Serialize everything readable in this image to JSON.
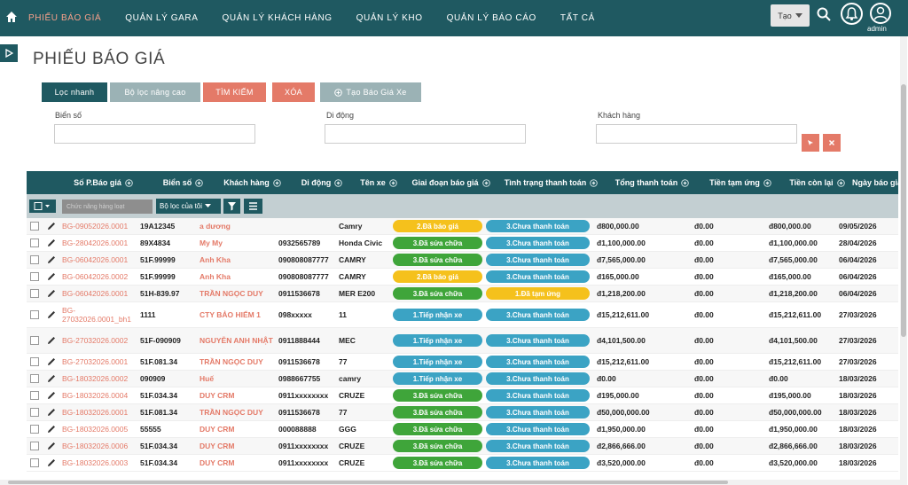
{
  "nav": {
    "items": [
      {
        "label": "PHIẾU BÁO GIÁ",
        "active": true
      },
      {
        "label": "QUẢN LÝ GARA",
        "active": false
      },
      {
        "label": "QUẢN LÝ KHÁCH HÀNG",
        "active": false
      },
      {
        "label": "QUẢN LÝ KHO",
        "active": false
      },
      {
        "label": "QUẢN LÝ BÁO CÁO",
        "active": false
      },
      {
        "label": "TẤT CẢ",
        "active": false
      }
    ],
    "create_label": "Tạo",
    "user_label": "admin"
  },
  "page": {
    "title": "PHIẾU BÁO GIÁ"
  },
  "tabs": {
    "quick": "Lọc nhanh",
    "advanced": "Bộ lọc nâng cao",
    "search": "TÌM KIẾM",
    "clear": "XÓA",
    "create": "Tạo Báo Giá Xe"
  },
  "filters": {
    "plate_label": "Biển số",
    "phone_label": "Di động",
    "customer_label": "Khách hàng",
    "plate_value": "",
    "phone_value": "",
    "customer_value": ""
  },
  "grid": {
    "headers": [
      "Số P.Báo giá",
      "Biển số",
      "Khách hàng",
      "Di động",
      "Tên xe",
      "Giai đoạn báo giá",
      "Tình trạng thanh toán",
      "Tổng thanh toán",
      "Tiền tạm ứng",
      "Tiền còn lại",
      "Ngày báo giá"
    ],
    "bulk_action": "Chức năng hàng loạt",
    "my_filter": "Bộ lọc của tôi",
    "rows": [
      {
        "code": "BG-09052026.0001",
        "plate": "19A12345",
        "customer": "a dương",
        "phone": "",
        "car": "Camry",
        "stage": "2.Đã báo giá",
        "stage_color": "#f5c11c",
        "pay": "3.Chưa thanh toán",
        "pay_color": "#3ba3c4",
        "total": "đ800,000.00",
        "advance": "đ0.00",
        "remain": "đ800,000.00",
        "date": "09/05/2026"
      },
      {
        "code": "BG-28042026.0001",
        "plate": "89X4834",
        "customer": "My My",
        "phone": "0932565789",
        "car": "Honda Civic",
        "stage": "3.Đã sửa chữa",
        "stage_color": "#3fa53a",
        "pay": "3.Chưa thanh toán",
        "pay_color": "#3ba3c4",
        "total": "đ1,100,000.00",
        "advance": "đ0.00",
        "remain": "đ1,100,000.00",
        "date": "28/04/2026"
      },
      {
        "code": "BG-06042026.0001",
        "plate": "51F.99999",
        "customer": "Anh Kha",
        "phone": "090808087777",
        "car": "CAMRY",
        "stage": "3.Đã sửa chữa",
        "stage_color": "#3fa53a",
        "pay": "3.Chưa thanh toán",
        "pay_color": "#3ba3c4",
        "total": "đ7,565,000.00",
        "advance": "đ0.00",
        "remain": "đ7,565,000.00",
        "date": "06/04/2026"
      },
      {
        "code": "BG-06042026.0002",
        "plate": "51F.99999",
        "customer": "Anh Kha",
        "phone": "090808087777",
        "car": "CAMRY",
        "stage": "2.Đã báo giá",
        "stage_color": "#f5c11c",
        "pay": "3.Chưa thanh toán",
        "pay_color": "#3ba3c4",
        "total": "đ165,000.00",
        "advance": "đ0.00",
        "remain": "đ165,000.00",
        "date": "06/04/2026"
      },
      {
        "code": "BG-06042026.0001",
        "plate": "51H-839.97",
        "customer": "TRẦN NGỌC DUY",
        "phone": "0911536678",
        "car": "MER E200",
        "stage": "3.Đã sửa chữa",
        "stage_color": "#3fa53a",
        "pay": "1.Đã tạm ứng",
        "pay_color": "#f5c11c",
        "total": "đ1,218,200.00",
        "advance": "đ0.00",
        "remain": "đ1,218,200.00",
        "date": "06/04/2026"
      },
      {
        "code": "BG-27032026.0001_bh1",
        "plate": "1111",
        "customer": "CTY BẢO HIỂM 1",
        "phone": "098xxxxx",
        "car": "11",
        "stage": "1.Tiếp nhận xe",
        "stage_color": "#3ba3c4",
        "pay": "3.Chưa thanh toán",
        "pay_color": "#3ba3c4",
        "total": "đ15,212,611.00",
        "advance": "đ0.00",
        "remain": "đ15,212,611.00",
        "date": "27/03/2026"
      },
      {
        "code": "BG-27032026.0002",
        "plate": "51F-090909",
        "customer": "NGUYỄN ANH NHẬT",
        "phone": "0911888444",
        "car": "MEC",
        "stage": "1.Tiếp nhận xe",
        "stage_color": "#3ba3c4",
        "pay": "3.Chưa thanh toán",
        "pay_color": "#3ba3c4",
        "total": "đ4,101,500.00",
        "advance": "đ0.00",
        "remain": "đ4,101,500.00",
        "date": "27/03/2026"
      },
      {
        "code": "BG-27032026.0001",
        "plate": "51F.081.34",
        "customer": "TRẦN NGỌC DUY",
        "phone": "0911536678",
        "car": "77",
        "stage": "1.Tiếp nhận xe",
        "stage_color": "#3ba3c4",
        "pay": "3.Chưa thanh toán",
        "pay_color": "#3ba3c4",
        "total": "đ15,212,611.00",
        "advance": "đ0.00",
        "remain": "đ15,212,611.00",
        "date": "27/03/2026"
      },
      {
        "code": "BG-18032026.0002",
        "plate": "090909",
        "customer": "Huế",
        "phone": "0988667755",
        "car": "camry",
        "stage": "1.Tiếp nhận xe",
        "stage_color": "#3ba3c4",
        "pay": "3.Chưa thanh toán",
        "pay_color": "#3ba3c4",
        "total": "đ0.00",
        "advance": "đ0.00",
        "remain": "đ0.00",
        "date": "18/03/2026"
      },
      {
        "code": "BG-18032026.0004",
        "plate": "51F.034.34",
        "customer": "DUY CRM",
        "phone": "0911xxxxxxxx",
        "car": "CRUZE",
        "stage": "3.Đã sửa chữa",
        "stage_color": "#3fa53a",
        "pay": "3.Chưa thanh toán",
        "pay_color": "#3ba3c4",
        "total": "đ195,000.00",
        "advance": "đ0.00",
        "remain": "đ195,000.00",
        "date": "18/03/2026"
      },
      {
        "code": "BG-18032026.0001",
        "plate": "51F.081.34",
        "customer": "TRẦN NGỌC DUY",
        "phone": "0911536678",
        "car": "77",
        "stage": "3.Đã sửa chữa",
        "stage_color": "#3fa53a",
        "pay": "3.Chưa thanh toán",
        "pay_color": "#3ba3c4",
        "total": "đ50,000,000.00",
        "advance": "đ0.00",
        "remain": "đ50,000,000.00",
        "date": "18/03/2026"
      },
      {
        "code": "BG-18032026.0005",
        "plate": "55555",
        "customer": "DUY CRM",
        "phone": "000088888",
        "car": "GGG",
        "stage": "3.Đã sửa chữa",
        "stage_color": "#3fa53a",
        "pay": "3.Chưa thanh toán",
        "pay_color": "#3ba3c4",
        "total": "đ1,950,000.00",
        "advance": "đ0.00",
        "remain": "đ1,950,000.00",
        "date": "18/03/2026"
      },
      {
        "code": "BG-18032026.0006",
        "plate": "51F.034.34",
        "customer": "DUY CRM",
        "phone": "0911xxxxxxxx",
        "car": "CRUZE",
        "stage": "3.Đã sửa chữa",
        "stage_color": "#3fa53a",
        "pay": "3.Chưa thanh toán",
        "pay_color": "#3ba3c4",
        "total": "đ2,866,666.00",
        "advance": "đ0.00",
        "remain": "đ2,866,666.00",
        "date": "18/03/2026"
      },
      {
        "code": "BG-18032026.0003",
        "plate": "51F.034.34",
        "customer": "DUY CRM",
        "phone": "0911xxxxxxxx",
        "car": "CRUZE",
        "stage": "3.Đã sửa chữa",
        "stage_color": "#3fa53a",
        "pay": "3.Chưa thanh toán",
        "pay_color": "#3ba3c4",
        "total": "đ3,520,000.00",
        "advance": "đ0.00",
        "remain": "đ3,520,000.00",
        "date": "18/03/2026"
      }
    ]
  }
}
